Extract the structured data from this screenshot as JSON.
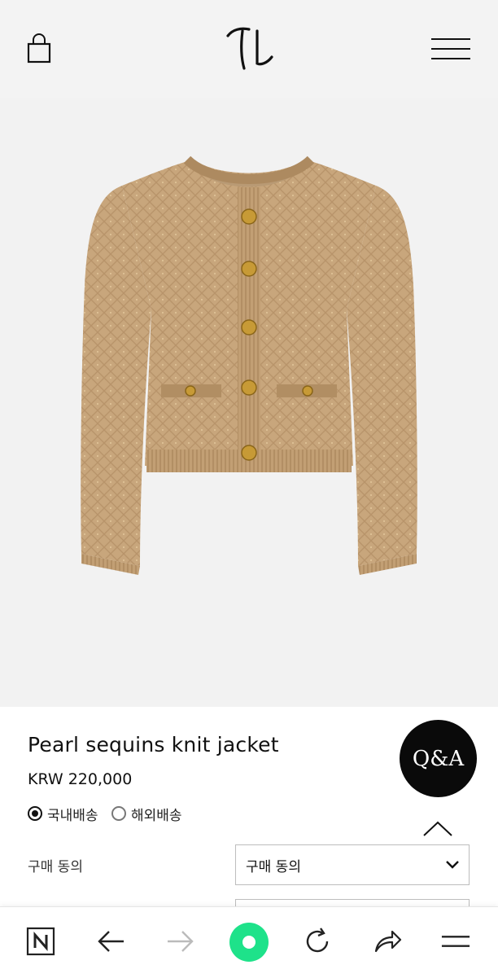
{
  "header": {
    "logo_icon": "brand-monogram-icon",
    "cart_icon": "shopping-bag-icon",
    "menu_icon": "hamburger-menu-icon"
  },
  "hero": {
    "image": "beige sequin knit cardigan jacket with gold buttons"
  },
  "product": {
    "title": "Pearl sequins knit jacket",
    "price": "KRW 220,000"
  },
  "shipping": {
    "options": [
      {
        "label": "국내배송",
        "selected": true
      },
      {
        "label": "해외배송",
        "selected": false
      }
    ]
  },
  "qa_button": {
    "label": "Q&A"
  },
  "purchase_agreement": {
    "label": "구매 동의",
    "select_value": "구매 동의"
  },
  "browser_bar": {
    "icons": [
      "naver-n-icon",
      "back-arrow-icon",
      "forward-arrow-icon",
      "home-dot-icon",
      "reload-icon",
      "share-icon",
      "menu-icon"
    ],
    "home_color": "#1ee28a"
  }
}
